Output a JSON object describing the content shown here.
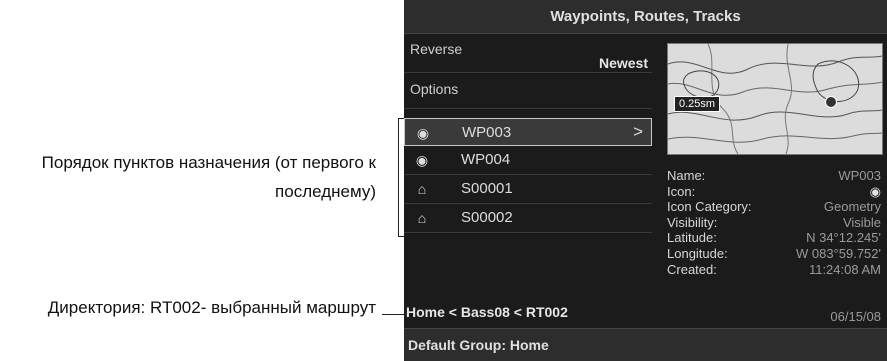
{
  "callouts": {
    "order_line1": "Порядок пунктов назначения (от первого к",
    "order_line2": "последнему)",
    "directory": "Директория: RT002- выбранный маршрут"
  },
  "title": "Waypoints, Routes, Tracks",
  "menu": {
    "reverse_label": "Reverse",
    "reverse_value": "Newest",
    "options_label": "Options"
  },
  "waypoints": [
    {
      "name": "WP003",
      "icon": "fish-icon",
      "glyph": "◉",
      "selected": true,
      "chevron": ">"
    },
    {
      "name": "WP004",
      "icon": "fish-icon",
      "glyph": "◉",
      "selected": false
    },
    {
      "name": "S00001",
      "icon": "home-icon",
      "glyph": "⌂",
      "selected": false
    },
    {
      "name": "S00002",
      "icon": "home-icon",
      "glyph": "⌂",
      "selected": false
    }
  ],
  "map": {
    "scale": "0.25sm"
  },
  "details": {
    "name_label": "Name:",
    "name_value": "WP003",
    "icon_label": "Icon:",
    "icon_value": "◉",
    "category_label": "Icon Category:",
    "category_value": "Geometry",
    "visibility_label": "Visibility:",
    "visibility_value": "Visible",
    "latitude_label": "Latitude:",
    "latitude_value": "N 34°12.245'",
    "longitude_label": "Longitude:",
    "longitude_value": "W 083°59.752'",
    "created_label": "Created:",
    "created_time": "11:24:08 AM",
    "created_date": "06/15/08"
  },
  "path": "Home < Bass08 < RT002",
  "footer": "Default Group: Home",
  "colors": {
    "panel_bg": "#1b1b1b",
    "bar_bg": "#2d2d2d",
    "value_gray": "#9a9a9a"
  }
}
